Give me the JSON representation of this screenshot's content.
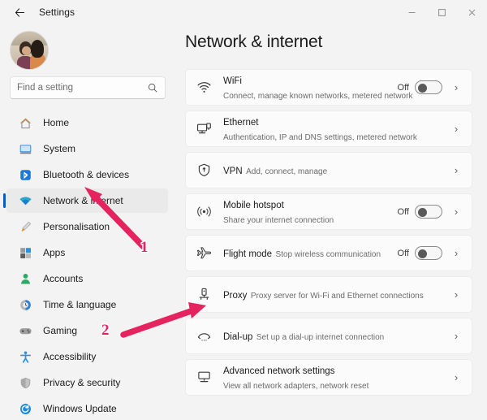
{
  "window": {
    "app_title": "Settings",
    "back_icon": "back-arrow-icon",
    "controls": {
      "minimize": "─",
      "maximize": "☐",
      "close": "✕"
    }
  },
  "sidebar": {
    "avatar": "user-avatar-photo",
    "search": {
      "placeholder": "Find a setting",
      "value": "",
      "icon": "search-icon"
    },
    "items": [
      {
        "label": "Home",
        "icon": "home-icon",
        "selected": false
      },
      {
        "label": "System",
        "icon": "system-monitor-icon",
        "selected": false
      },
      {
        "label": "Bluetooth & devices",
        "icon": "bluetooth-icon",
        "selected": false
      },
      {
        "label": "Network & internet",
        "icon": "wifi-icon",
        "selected": true
      },
      {
        "label": "Personalisation",
        "icon": "paintbrush-icon",
        "selected": false
      },
      {
        "label": "Apps",
        "icon": "apps-icon",
        "selected": false
      },
      {
        "label": "Accounts",
        "icon": "account-person-icon",
        "selected": false
      },
      {
        "label": "Time & language",
        "icon": "clock-globe-icon",
        "selected": false
      },
      {
        "label": "Gaming",
        "icon": "gamepad-icon",
        "selected": false
      },
      {
        "label": "Accessibility",
        "icon": "accessibility-icon",
        "selected": false
      },
      {
        "label": "Privacy & security",
        "icon": "shield-icon",
        "selected": false
      },
      {
        "label": "Windows Update",
        "icon": "update-refresh-icon",
        "selected": false
      }
    ]
  },
  "main": {
    "page_title": "Network & internet",
    "cards": [
      {
        "title": "WiFi",
        "subtitle": "Connect, manage known networks, metered network",
        "icon": "wifi-icon",
        "toggle": true,
        "toggle_state": "Off",
        "chevron": "›"
      },
      {
        "title": "Ethernet",
        "subtitle": "Authentication, IP and DNS settings, metered network",
        "icon": "ethernet-icon",
        "toggle": false,
        "toggle_state": "",
        "chevron": "›"
      },
      {
        "title": "VPN",
        "subtitle": "Add, connect, manage",
        "icon": "vpn-shield-icon",
        "toggle": false,
        "toggle_state": "",
        "chevron": "›"
      },
      {
        "title": "Mobile hotspot",
        "subtitle": "Share your internet connection",
        "icon": "hotspot-icon",
        "toggle": true,
        "toggle_state": "Off",
        "chevron": "›"
      },
      {
        "title": "Flight mode",
        "subtitle": "Stop wireless communication",
        "icon": "airplane-icon",
        "toggle": true,
        "toggle_state": "Off",
        "chevron": "›"
      },
      {
        "title": "Proxy",
        "subtitle": "Proxy server for Wi-Fi and Ethernet connections",
        "icon": "proxy-icon",
        "toggle": false,
        "toggle_state": "",
        "chevron": "›"
      },
      {
        "title": "Dial-up",
        "subtitle": "Set up a dial-up internet connection",
        "icon": "dialup-phone-icon",
        "toggle": false,
        "toggle_state": "",
        "chevron": "›"
      },
      {
        "title": "Advanced network settings",
        "subtitle": "View all network adapters, network reset",
        "icon": "advanced-network-icon",
        "toggle": false,
        "toggle_state": "",
        "chevron": "›"
      }
    ]
  },
  "annotations": {
    "color": "#e5245f",
    "markers": [
      {
        "label": "1",
        "points_to": "sidebar-item-network-internet"
      },
      {
        "label": "2",
        "points_to": "card-proxy"
      }
    ]
  }
}
